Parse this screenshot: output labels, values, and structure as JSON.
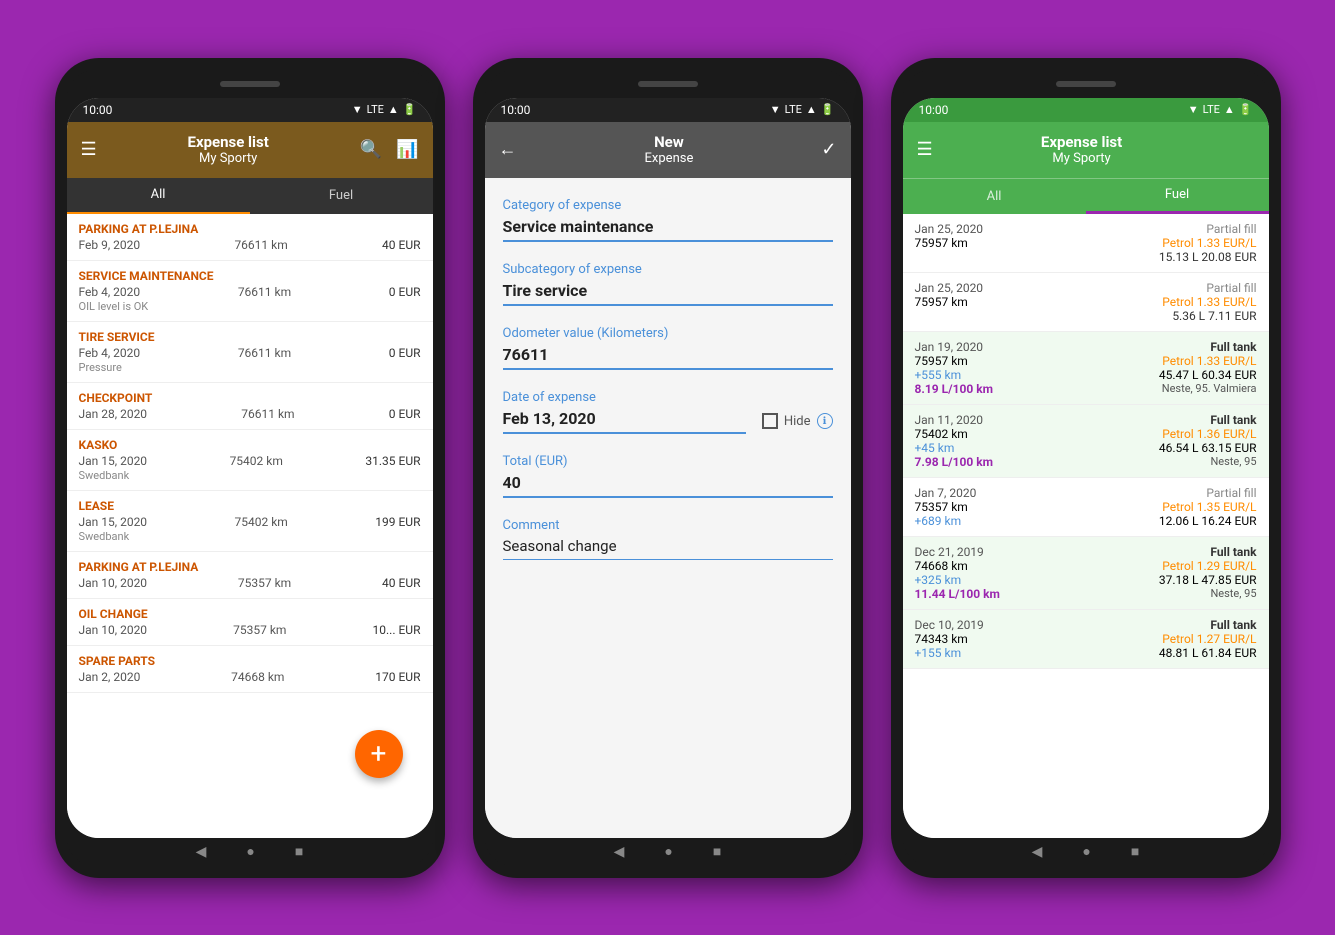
{
  "statusBar": {
    "time": "10:00",
    "signal": "▼ LTE ▲ 🔋"
  },
  "phone1": {
    "header": {
      "title": "Expense list",
      "subtitle": "My Sporty",
      "menuIcon": "☰",
      "searchIcon": "🔍",
      "chartIcon": "📊"
    },
    "tabs": [
      {
        "label": "All",
        "active": true
      },
      {
        "label": "Fuel",
        "active": false
      }
    ],
    "expenses": [
      {
        "title": "PARKING AT P.LEJINA",
        "date": "Feb 9, 2020",
        "km": "76611 km",
        "amount": "40 EUR",
        "note": ""
      },
      {
        "title": "SERVICE MAINTENANCE",
        "date": "Feb 4, 2020",
        "km": "76611 km",
        "amount": "0 EUR",
        "note": "OIL level is OK"
      },
      {
        "title": "TIRE SERVICE",
        "date": "Feb 4, 2020",
        "km": "76611 km",
        "amount": "0 EUR",
        "note": "Pressure"
      },
      {
        "title": "CHECKPOINT",
        "date": "Jan 28, 2020",
        "km": "76611 km",
        "amount": "0 EUR",
        "note": ""
      },
      {
        "title": "KASKO",
        "date": "Jan 15, 2020",
        "km": "75402 km",
        "amount": "31.35 EUR",
        "note": "Swedbank"
      },
      {
        "title": "LEASE",
        "date": "Jan 15, 2020",
        "km": "75402 km",
        "amount": "199 EUR",
        "note": "Swedbank"
      },
      {
        "title": "PARKING AT P.LEJINA",
        "date": "Jan 10, 2020",
        "km": "75357 km",
        "amount": "40 EUR",
        "note": ""
      },
      {
        "title": "OIL CHANGE",
        "date": "Jan 10, 2020",
        "km": "75357 km",
        "amount": "10... EUR",
        "note": ""
      },
      {
        "title": "SPARE PARTS",
        "date": "Jan 2, 2020",
        "km": "74668 km",
        "amount": "170 EUR",
        "note": ""
      }
    ],
    "fab": "+"
  },
  "phone2": {
    "header": {
      "backIcon": "←",
      "title": "New",
      "subtitle": "Expense",
      "checkIcon": "✓"
    },
    "form": {
      "categoryLabel": "Category of expense",
      "categoryValue": "Service maintenance",
      "subcategoryLabel": "Subcategory of expense",
      "subcategoryValue": "Tire service",
      "odometerLabel": "Odometer value (Kilometers)",
      "odometerValue": "76611",
      "dateLabel": "Date of expense",
      "dateValue": "Feb 13, 2020",
      "hideLabel": "Hide",
      "infoIcon": "ℹ",
      "totalLabel": "Total (EUR)",
      "totalValue": "40",
      "commentLabel": "Comment",
      "commentValue": "Seasonal change"
    }
  },
  "phone3": {
    "header": {
      "title": "Expense list",
      "subtitle": "My Sporty",
      "menuIcon": "☰"
    },
    "tabs": [
      {
        "label": "All",
        "active": false
      },
      {
        "label": "Fuel",
        "active": true
      }
    ],
    "fuelEntries": [
      {
        "date": "Jan 25, 2020",
        "km": "75957 km",
        "fillType": "Partial fill",
        "fuelType": "Petrol 1.33 EUR/L",
        "amount": "15.13 L  20.08 EUR",
        "efficiency": "",
        "station": ""
      },
      {
        "date": "Jan 25, 2020",
        "km": "75957 km",
        "fillType": "Partial fill",
        "fuelType": "Petrol 1.33 EUR/L",
        "amount": "5.36 L  7.11 EUR",
        "efficiency": "",
        "station": ""
      },
      {
        "date": "Jan 19, 2020",
        "km": "75957 km",
        "kmDelta": "+555 km",
        "fillType": "Full tank",
        "fuelType": "Petrol 1.33 EUR/L",
        "amount": "45.47 L  60.34 EUR",
        "efficiency": "8.19 L/100 km",
        "station": "Neste,  95. Valmiera"
      },
      {
        "date": "Jan 11, 2020",
        "km": "75402 km",
        "kmDelta": "+45 km",
        "fillType": "Full tank",
        "fuelType": "Petrol 1.36 EUR/L",
        "amount": "46.54 L  63.15 EUR",
        "efficiency": "7.98 L/100 km",
        "station": "Neste,  95"
      },
      {
        "date": "Jan 7, 2020",
        "km": "75357 km",
        "kmDelta": "+689 km",
        "fillType": "Partial fill",
        "fuelType": "Petrol 1.35 EUR/L",
        "amount": "12.06 L  16.24 EUR",
        "efficiency": "",
        "station": ""
      },
      {
        "date": "Dec 21, 2019",
        "km": "74668 km",
        "kmDelta": "+325 km",
        "fillType": "Full tank",
        "fuelType": "Petrol 1.29 EUR/L",
        "amount": "37.18 L  47.85 EUR",
        "efficiency": "11.44 L/100 km",
        "station": "Neste,  95"
      },
      {
        "date": "Dec 10, 2019",
        "km": "74343 km",
        "kmDelta": "+155 km",
        "fillType": "Full tank",
        "fuelType": "Petrol 1.27 EUR/L",
        "amount": "48.81 L  61.84 EUR",
        "efficiency": "",
        "station": ""
      }
    ]
  }
}
